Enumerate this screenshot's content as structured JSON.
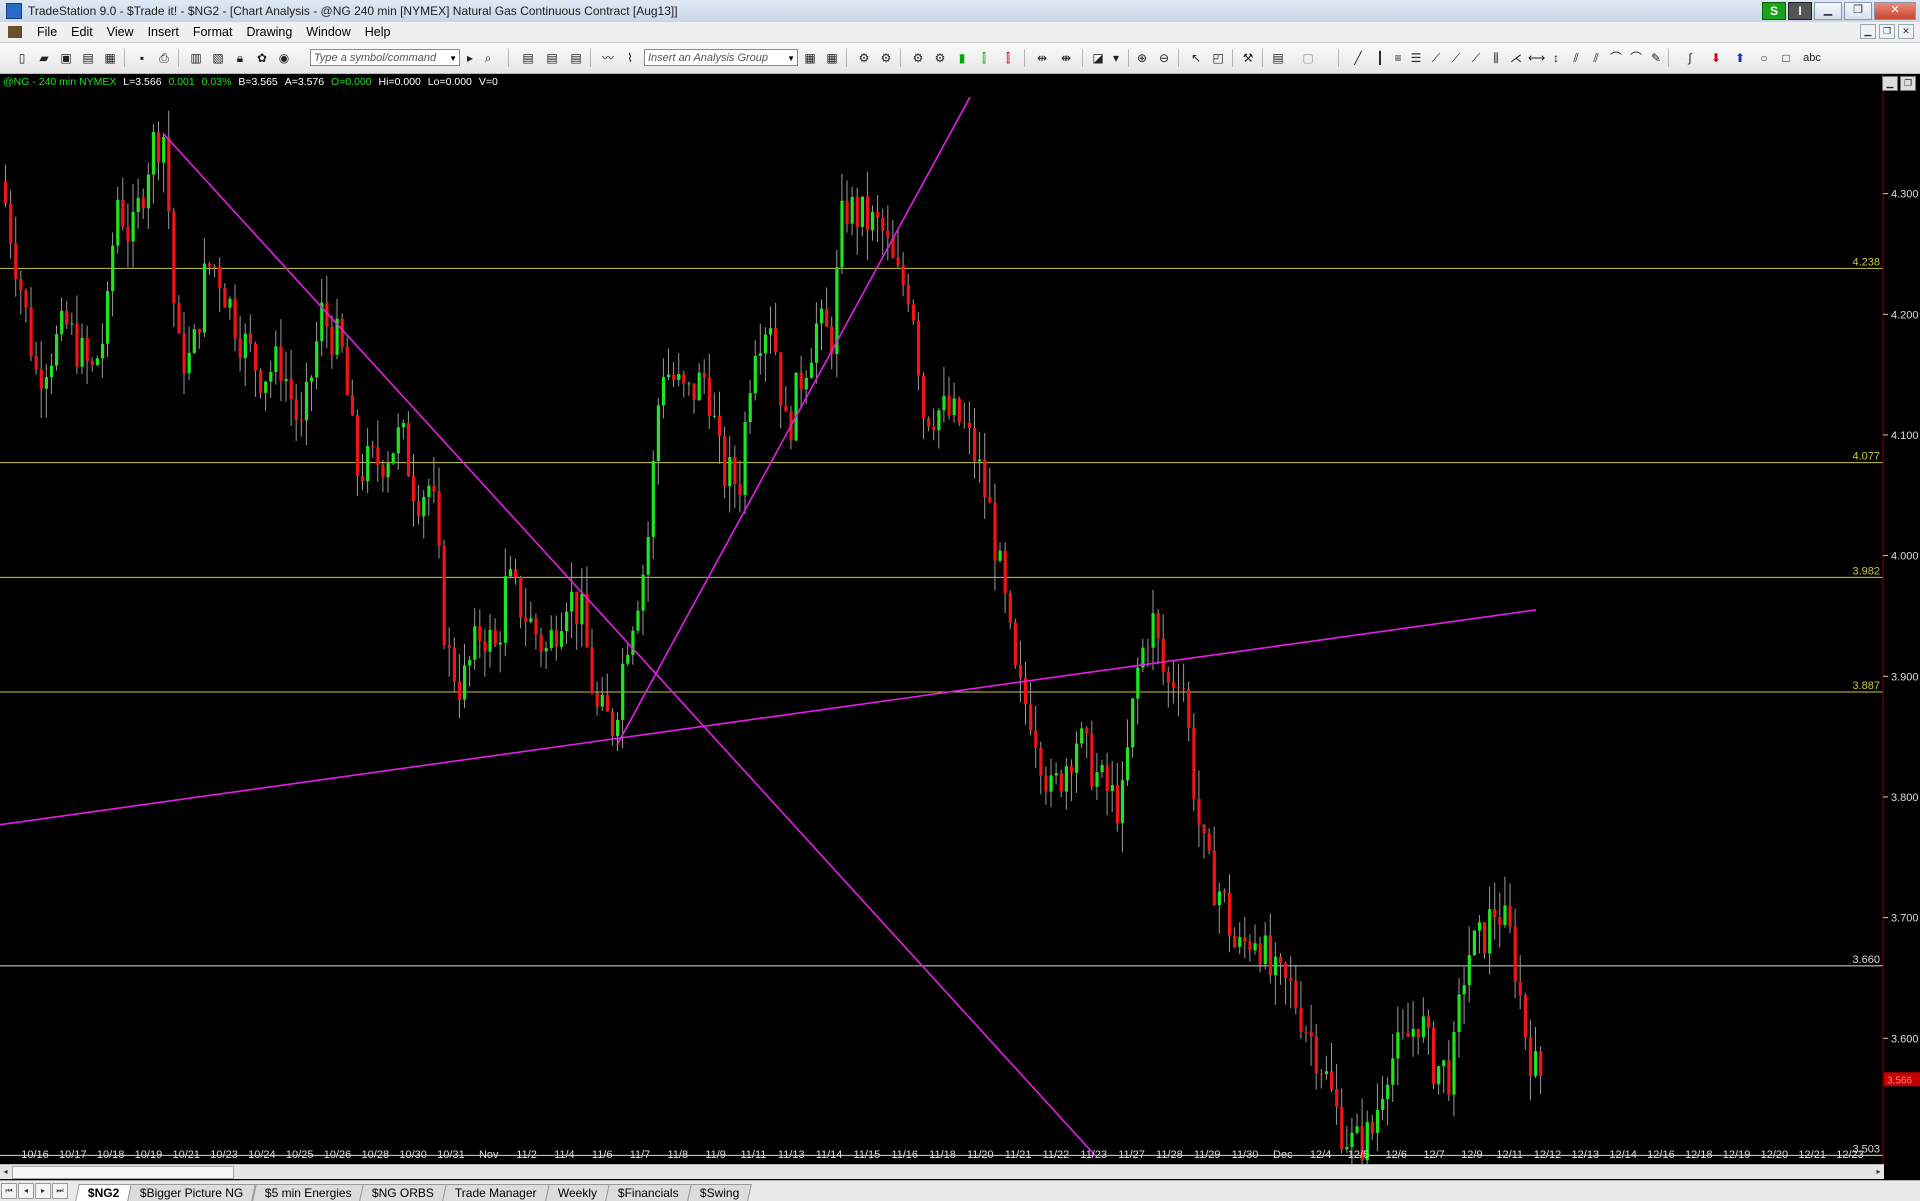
{
  "window": {
    "title": "TradeStation 9.0 - $Trade it! - $NG2 - [Chart Analysis - @NG 240 min [NYMEX] Natural Gas Continuous Contract [Aug13]]",
    "badge_s": "S",
    "badge_i": "I"
  },
  "menu": [
    "File",
    "Edit",
    "View",
    "Insert",
    "Format",
    "Drawing",
    "Window",
    "Help"
  ],
  "toolbar": {
    "symbol_placeholder": "Type a symbol/command",
    "analysis_placeholder": "Insert an Analysis Group",
    "abc_label": "abc"
  },
  "status": {
    "symbol": "@NG - 240 min  NYMEX",
    "last": "L=3.566",
    "change": "0.001",
    "pct": "0.03%",
    "bid": "B=3.565",
    "ask": "A=3.576",
    "open": "O=0.000",
    "high": "Hi=0.000",
    "low": "Lo=0.000",
    "volume": "V=0"
  },
  "colors": {
    "up": "#1ee61e",
    "down": "#f01414",
    "trendline": "#e61ee6",
    "level": "#c8c83c",
    "level_white": "#d8d8d8",
    "status_green": "#22e022",
    "status_white": "#ffffff"
  },
  "chart_data": {
    "type": "candlestick",
    "y_ticks": [
      "4.300",
      "4.200",
      "4.100",
      "4.000",
      "3.900",
      "3.800",
      "3.700",
      "3.600"
    ],
    "levels": [
      {
        "value": 4.238,
        "label": "4.238",
        "color": "level"
      },
      {
        "value": 4.077,
        "label": "4.077",
        "color": "level"
      },
      {
        "value": 3.982,
        "label": "3.982",
        "color": "level"
      },
      {
        "value": 3.887,
        "label": "3.887",
        "color": "level"
      },
      {
        "value": 3.66,
        "label": "3.660",
        "color": "level_white"
      },
      {
        "value": 3.503,
        "label": "3.503",
        "color": "level_white"
      }
    ],
    "last_price_label": "3.566",
    "x_labels": [
      "10/16",
      "10/17",
      "10/18",
      "10/19",
      "10/21",
      "10/23",
      "10/24",
      "10/25",
      "10/26",
      "10/28",
      "10/30",
      "10/31",
      "Nov",
      "11/2",
      "11/4",
      "11/6",
      "11/7",
      "11/8",
      "11/9",
      "11/11",
      "11/13",
      "11/14",
      "11/15",
      "11/16",
      "11/18",
      "11/20",
      "11/21",
      "11/22",
      "11/23",
      "11/27",
      "11/28",
      "11/29",
      "11/30",
      "Dec",
      "12/4",
      "12/5",
      "12/6",
      "12/7",
      "12/9",
      "12/11",
      "12/12",
      "12/13",
      "12/14",
      "12/16",
      "12/18",
      "12/19",
      "12/20",
      "12/21",
      "12/23"
    ],
    "y_axis": {
      "min": 3.49,
      "max": 4.39
    },
    "anchors": [
      [
        0,
        4.31
      ],
      [
        20,
        4.22
      ],
      [
        35,
        4.15
      ],
      [
        65,
        4.19
      ],
      [
        90,
        4.15
      ],
      [
        105,
        4.19
      ],
      [
        115,
        4.3
      ],
      [
        130,
        4.26
      ],
      [
        150,
        4.34
      ],
      [
        163,
        4.35
      ],
      [
        175,
        4.17
      ],
      [
        190,
        4.16
      ],
      [
        205,
        4.24
      ],
      [
        215,
        4.24
      ],
      [
        240,
        4.18
      ],
      [
        260,
        4.15
      ],
      [
        280,
        4.16
      ],
      [
        300,
        4.1
      ],
      [
        320,
        4.2
      ],
      [
        340,
        4.17
      ],
      [
        355,
        4.07
      ],
      [
        380,
        4.08
      ],
      [
        400,
        4.1
      ],
      [
        415,
        4.05
      ],
      [
        430,
        4.06
      ],
      [
        445,
        3.92
      ],
      [
        460,
        3.89
      ],
      [
        480,
        3.94
      ],
      [
        495,
        3.92
      ],
      [
        505,
        3.98
      ],
      [
        525,
        3.95
      ],
      [
        545,
        3.92
      ],
      [
        565,
        3.97
      ],
      [
        580,
        3.95
      ],
      [
        595,
        3.87
      ],
      [
        612,
        3.86
      ],
      [
        625,
        3.93
      ],
      [
        645,
        4.0
      ],
      [
        660,
        4.16
      ],
      [
        685,
        4.13
      ],
      [
        705,
        4.15
      ],
      [
        720,
        4.07
      ],
      [
        738,
        4.06
      ],
      [
        752,
        4.18
      ],
      [
        770,
        4.2
      ],
      [
        785,
        4.1
      ],
      [
        800,
        4.15
      ],
      [
        815,
        4.19
      ],
      [
        830,
        4.18
      ],
      [
        842,
        4.29
      ],
      [
        860,
        4.28
      ],
      [
        880,
        4.27
      ],
      [
        895,
        4.23
      ],
      [
        910,
        4.22
      ],
      [
        922,
        4.12
      ],
      [
        940,
        4.12
      ],
      [
        960,
        4.11
      ],
      [
        975,
        4.08
      ],
      [
        990,
        4.03
      ],
      [
        1005,
        3.95
      ],
      [
        1015,
        3.89
      ],
      [
        1030,
        3.87
      ],
      [
        1050,
        3.8
      ],
      [
        1075,
        3.85
      ],
      [
        1100,
        3.81
      ],
      [
        1120,
        3.79
      ],
      [
        1135,
        3.9
      ],
      [
        1150,
        3.95
      ],
      [
        1165,
        3.89
      ],
      [
        1180,
        3.91
      ],
      [
        1195,
        3.79
      ],
      [
        1205,
        3.74
      ],
      [
        1220,
        3.72
      ],
      [
        1235,
        3.67
      ],
      [
        1255,
        3.69
      ],
      [
        1270,
        3.65
      ],
      [
        1290,
        3.64
      ],
      [
        1305,
        3.61
      ],
      [
        1320,
        3.58
      ],
      [
        1338,
        3.53
      ],
      [
        1352,
        3.51
      ],
      [
        1370,
        3.52
      ],
      [
        1385,
        3.58
      ],
      [
        1400,
        3.59
      ],
      [
        1418,
        3.62
      ],
      [
        1430,
        3.58
      ],
      [
        1450,
        3.57
      ],
      [
        1465,
        3.67
      ],
      [
        1480,
        3.68
      ],
      [
        1495,
        3.71
      ],
      [
        1510,
        3.68
      ],
      [
        1525,
        3.6
      ],
      [
        1535,
        3.57
      ]
    ],
    "trendlines": [
      {
        "x1": 163,
        "y1": 4.35,
        "x2": 1095,
        "y2": 3.503
      },
      {
        "x1": 0,
        "y1": 3.777,
        "x2": 1536,
        "y2": 3.955
      },
      {
        "x1": 617,
        "y1": 3.843,
        "x2": 970,
        "y2": 4.38
      }
    ]
  },
  "tabs": [
    "$NG2",
    "$Bigger Picture NG",
    "$5 min Energies",
    "$NG ORBS",
    "Trade Manager",
    "Weekly",
    "$Financials",
    "$Swing"
  ],
  "active_tab": "$NG2"
}
